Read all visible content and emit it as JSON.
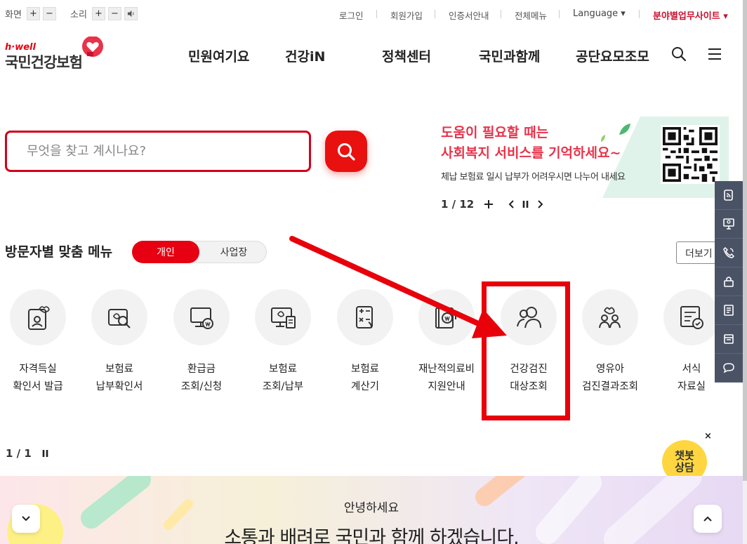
{
  "util": {
    "screen_label": "화면",
    "sound_label": "소리",
    "plus": "+",
    "minus": "−",
    "links": [
      "로그인",
      "회원가입",
      "인증서안내",
      "전체메뉴"
    ],
    "language": "Language ▾",
    "site": "분야별업무사이트 ▾"
  },
  "logo": {
    "hwell": "h·well",
    "name": "국민건강보험"
  },
  "gnb": [
    "민원여기요",
    "건강iN",
    "정책센터",
    "국민과함께",
    "공단요모조모"
  ],
  "search": {
    "placeholder": "무엇을 찾고 계시나요?"
  },
  "banner": {
    "line1": "도움이 필요할 때는",
    "line2": "사회복지 서비스를 기억하세요~",
    "line3": "체납 보험료 일시 납부가 어려우시면 나누어 내세요",
    "pager": "1 / 12"
  },
  "section": {
    "title": "방문자별 맞춤 메뉴",
    "toggle_on": "개인",
    "toggle_off": "사업장",
    "more": "더보기"
  },
  "menu": [
    {
      "label": "자격득실\n확인서 발급",
      "icon": "id-card-heart-icon"
    },
    {
      "label": "보험료\n납부확인서",
      "icon": "document-search-icon"
    },
    {
      "label": "환급금\n조회/신청",
      "icon": "monitor-won-icon"
    },
    {
      "label": "보험료\n조회/납부",
      "icon": "monitor-doc-icon"
    },
    {
      "label": "보험료\n계산기",
      "icon": "calculator-icon"
    },
    {
      "label": "재난적의료비\n지원안내",
      "icon": "book-won-icon"
    },
    {
      "label": "건강검진\n대상조회",
      "icon": "people-search-icon"
    },
    {
      "label": "영유아\n검진결과조회",
      "icon": "family-heart-icon"
    },
    {
      "label": "서식\n자료실",
      "icon": "form-check-icon"
    }
  ],
  "menu_pager": "1 / 1",
  "chatbot": {
    "label": "챗봇\n상담",
    "close": "×"
  },
  "promo": {
    "hello": "안녕하세요",
    "slogan": "소통과 배려로 국민과 함께 하겠습니다."
  },
  "colors": {
    "brand": "#e60012",
    "side": "#4a5366",
    "chatbot": "#ffd640"
  }
}
